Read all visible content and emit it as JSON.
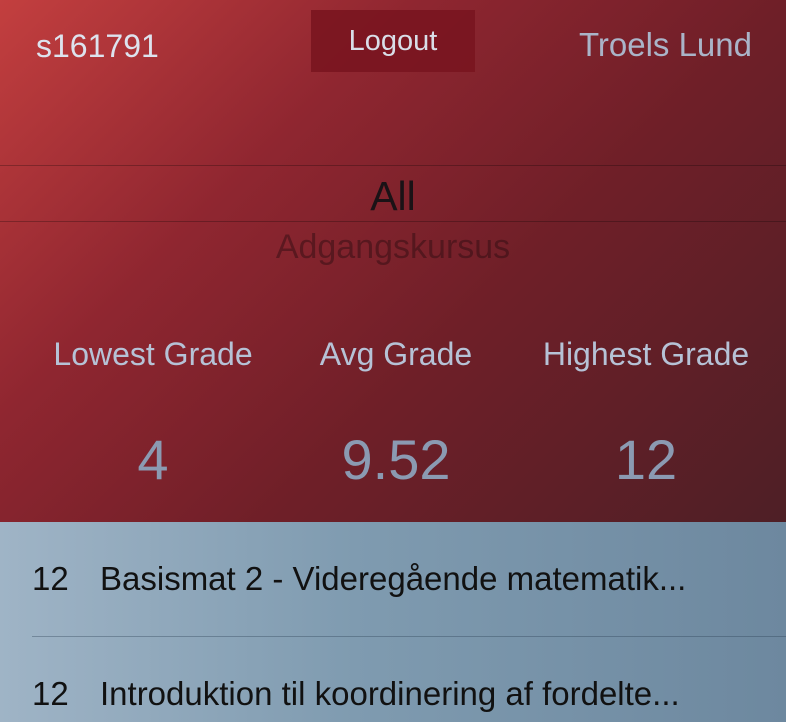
{
  "header": {
    "student_id": "s161791",
    "logout_label": "Logout",
    "user_name": "Troels Lund"
  },
  "filter": {
    "selected": "All",
    "next_option": "Adgangskursus"
  },
  "stats": {
    "lowest_label": "Lowest Grade",
    "lowest_value": "4",
    "avg_label": "Avg Grade",
    "avg_value": "9.52",
    "highest_label": "Highest Grade",
    "highest_value": "12"
  },
  "courses": [
    {
      "grade": "12",
      "title": "Basismat 2 - Videregående matematik..."
    },
    {
      "grade": "12",
      "title": "Introduktion til koordinering af fordelte..."
    }
  ],
  "colors": {
    "header_gradient_start": "#c33f3f",
    "header_gradient_end": "#4e1f26",
    "list_background": "#7f9bb0"
  }
}
